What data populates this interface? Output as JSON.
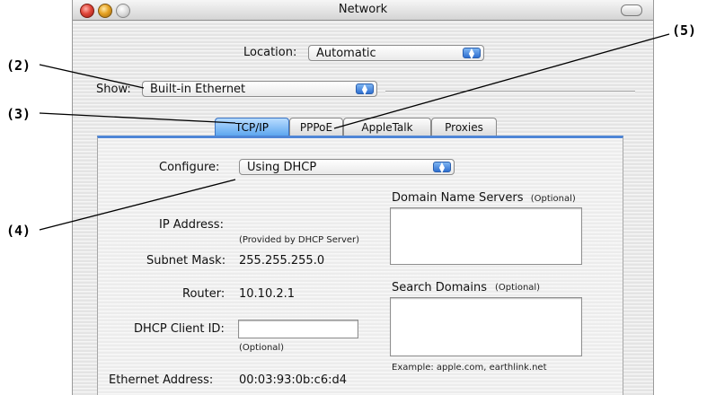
{
  "window": {
    "title": "Network"
  },
  "location": {
    "label": "Location:",
    "value": "Automatic"
  },
  "show": {
    "label": "Show:",
    "value": "Built-in Ethernet"
  },
  "tabs": [
    {
      "label": "TCP/IP",
      "active": true
    },
    {
      "label": "PPPoE",
      "active": false
    },
    {
      "label": "AppleTalk",
      "active": false
    },
    {
      "label": "Proxies",
      "active": false
    }
  ],
  "tcpip": {
    "configure_label": "Configure:",
    "configure_value": "Using DHCP",
    "ip_label": "IP Address:",
    "ip_note": "(Provided by DHCP Server)",
    "subnet_label": "Subnet Mask:",
    "subnet_value": "255.255.255.0",
    "router_label": "Router:",
    "router_value": "10.10.2.1",
    "dhcp_label": "DHCP Client ID:",
    "dhcp_value": "",
    "dhcp_note": "(Optional)",
    "ethernet_label": "Ethernet Address:",
    "ethernet_value": "00:03:93:0b:c6:d4",
    "dns_label": "Domain Name Servers",
    "dns_optional": "(Optional)",
    "search_label": "Search Domains",
    "search_optional": "(Optional)",
    "example": "Example: apple.com, earthlink.net"
  },
  "callouts": {
    "c2": "(2)",
    "c3": "(3)",
    "c4": "(4)",
    "c5": "(5)"
  },
  "colors": {
    "accent": "#4f86d6",
    "tab_active": "#5ea7ef",
    "callout_line": "#000000"
  }
}
